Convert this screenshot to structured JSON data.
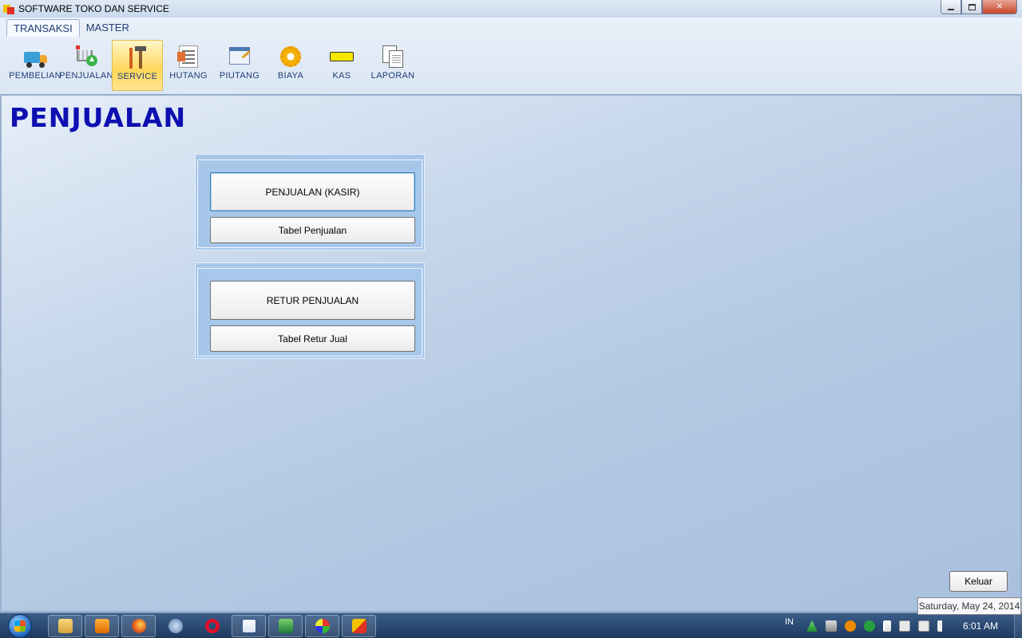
{
  "window": {
    "title": "SOFTWARE TOKO DAN SERVICE",
    "controls": [
      "minimize",
      "maximize",
      "close"
    ]
  },
  "ribbon": {
    "tabs": [
      {
        "label": "TRANSAKSI",
        "active": true
      },
      {
        "label": "MASTER",
        "active": false
      }
    ],
    "tools": [
      {
        "label": "PEMBELIAN",
        "icon": "truck-icon"
      },
      {
        "label": "PENJUALAN",
        "icon": "cart-icon"
      },
      {
        "label": "SERVICE",
        "icon": "tools-icon",
        "active": true
      },
      {
        "label": "HUTANG",
        "icon": "ledger-icon"
      },
      {
        "label": "PIUTANG",
        "icon": "invoice-icon"
      },
      {
        "label": "BIAYA",
        "icon": "gear-icon"
      },
      {
        "label": "KAS",
        "icon": "cash-icon"
      },
      {
        "label": "LAPORAN",
        "icon": "report-icon"
      }
    ]
  },
  "main": {
    "page_title": "PENJUALAN",
    "panels": [
      {
        "primary": "PENJUALAN (KASIR)",
        "secondary": "Tabel Penjualan"
      },
      {
        "primary": "RETUR PENJUALAN",
        "secondary": "Tabel Retur Jual"
      }
    ],
    "exit_button": "Keluar"
  },
  "tooltip": "Saturday, May 24, 2014",
  "taskbar": {
    "language": "IN",
    "clock": "6:01 AM",
    "apps": [
      "explorer-icon",
      "media-player-icon",
      "firefox-icon",
      "browser-icon",
      "opera-icon",
      "word-icon",
      "excel-icon",
      "paint-icon",
      "app-window-icon"
    ]
  },
  "colors": {
    "title": "#0d0fb0",
    "ribbon_label": "#1e3d75",
    "active_tool": "#ffd75a",
    "panel_bg": "#a7c7ea"
  }
}
